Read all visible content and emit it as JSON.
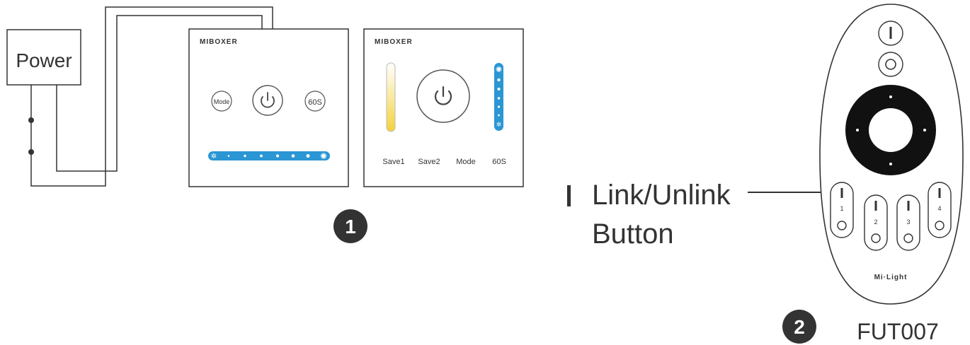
{
  "power": {
    "label": "Power"
  },
  "panel1": {
    "brand": "MIBOXER",
    "mode_label": "Mode",
    "timer_label": "60S"
  },
  "panel2": {
    "brand": "MIBOXER",
    "labels": [
      "Save1",
      "Save2",
      "Mode",
      "60S"
    ]
  },
  "remote": {
    "brand": "Mi·Light",
    "zone_numbers": [
      "1",
      "2",
      "3",
      "4"
    ],
    "model": "FUT007"
  },
  "callout": {
    "line1": "Link/Unlink",
    "line2": "Button"
  },
  "steps": [
    "1",
    "2"
  ],
  "colors": {
    "line": "#333333",
    "accent_blue": "#2a96d4",
    "warm_yellow": "#f4d23c",
    "badge": "#333333"
  }
}
